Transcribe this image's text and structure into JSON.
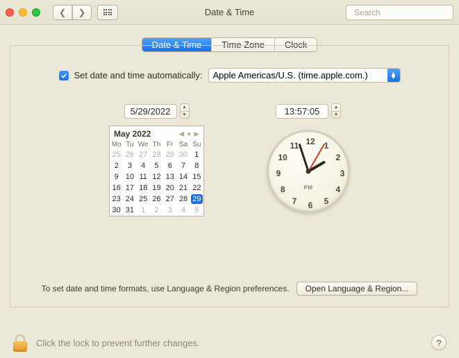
{
  "window": {
    "title": "Date & Time"
  },
  "search": {
    "placeholder": "Search"
  },
  "tabs": {
    "datetime": "Date & Time",
    "timezone": "Time Zone",
    "clock": "Clock"
  },
  "auto": {
    "label": "Set date and time automatically:",
    "server": "Apple Americas/U.S. (time.apple.com.)"
  },
  "date_stepper": "5/29/2022",
  "time_stepper": "13:57:05",
  "calendar": {
    "title": "May 2022",
    "dow": [
      "Mo",
      "Tu",
      "We",
      "Th",
      "Fr",
      "Sa",
      "Su"
    ],
    "prev_tail": [
      "25",
      "26",
      "27",
      "28",
      "29",
      "30"
    ],
    "days": [
      "1",
      "2",
      "3",
      "4",
      "5",
      "6",
      "7",
      "8",
      "9",
      "10",
      "11",
      "12",
      "13",
      "14",
      "15",
      "16",
      "17",
      "18",
      "19",
      "20",
      "21",
      "22",
      "23",
      "24",
      "25",
      "26",
      "27",
      "28",
      "29",
      "30",
      "31"
    ],
    "next_head": [
      "1",
      "2",
      "3",
      "4",
      "5"
    ],
    "selected": "29"
  },
  "clock": {
    "ampm": "PM",
    "numbers": [
      "12",
      "1",
      "2",
      "3",
      "4",
      "5",
      "6",
      "7",
      "8",
      "9",
      "10",
      "11"
    ]
  },
  "footer": {
    "hint": "To set date and time formats, use Language & Region preferences.",
    "button": "Open Language & Region..."
  },
  "lock": {
    "text": "Click the lock to prevent further changes."
  },
  "help": "?"
}
